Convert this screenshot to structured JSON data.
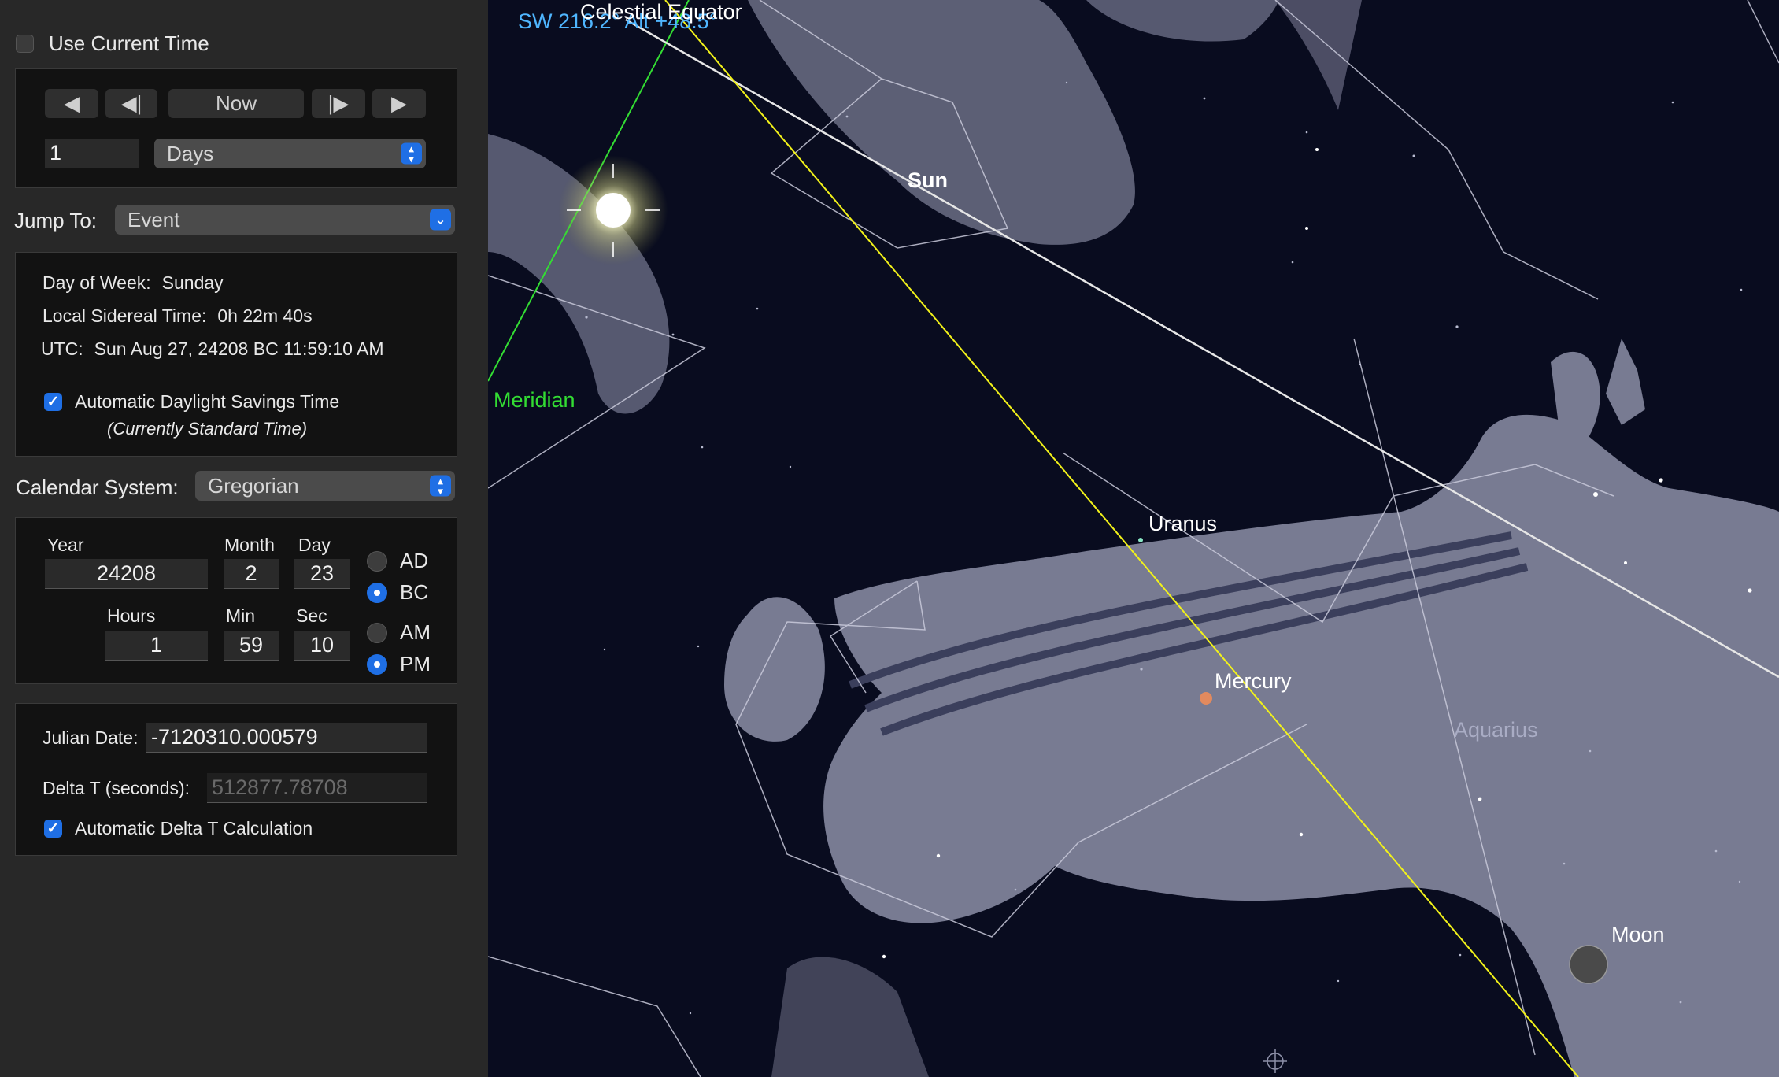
{
  "time_panel": {
    "use_current_time": {
      "label": "Use Current Time",
      "checked": false
    },
    "nav": {
      "now_label": "Now",
      "step_value": "1",
      "step_unit": "Days"
    },
    "jump_to": {
      "label": "Jump To:",
      "value": "Event"
    },
    "info": {
      "day_of_week_label": "Day of Week:",
      "day_of_week": "Sunday",
      "lst_label": "Local Sidereal Time:",
      "lst": "0h 22m 40s",
      "utc_label": "UTC:",
      "utc": "Sun Aug 27, 24208 BC 11:59:10 AM",
      "dst_label": "Automatic Daylight Savings Time",
      "dst_checked": true,
      "dst_note": "(Currently Standard Time)"
    },
    "calendar": {
      "label": "Calendar System:",
      "value": "Gregorian"
    },
    "date": {
      "year_label": "Year",
      "year": "24208",
      "month_label": "Month",
      "month": "2",
      "day_label": "Day",
      "day": "23",
      "era_ad": "AD",
      "era_bc": "BC",
      "era_selected": "BC",
      "hours_label": "Hours",
      "hours": "1",
      "min_label": "Min",
      "min": "59",
      "sec_label": "Sec",
      "sec": "10",
      "ampm_am": "AM",
      "ampm_pm": "PM",
      "ampm_selected": "PM"
    },
    "julian": {
      "julian_label": "Julian Date:",
      "julian_value": "-7120310.000579",
      "delta_t_label": "Delta T (seconds):",
      "delta_t_value": "512877.78708",
      "auto_delta_label": "Automatic Delta T Calculation",
      "auto_delta_checked": true
    }
  },
  "sky": {
    "pointer_readout": "SW 216.2° Alt +48.5°",
    "celestial_equator_label": "Celestial Equator",
    "meridian_label": "Meridian",
    "sun_label": "Sun",
    "uranus_label": "Uranus",
    "mercury_label": "Mercury",
    "moon_label": "Moon",
    "constellation_label": "Aquarius",
    "colors": {
      "background": "#090c1f",
      "ecliptic": "#f2f21a",
      "meridian": "#33dd33",
      "equator": "#e6e6e6",
      "readout": "#4fb6ff",
      "figure": "#8d90a8"
    }
  }
}
